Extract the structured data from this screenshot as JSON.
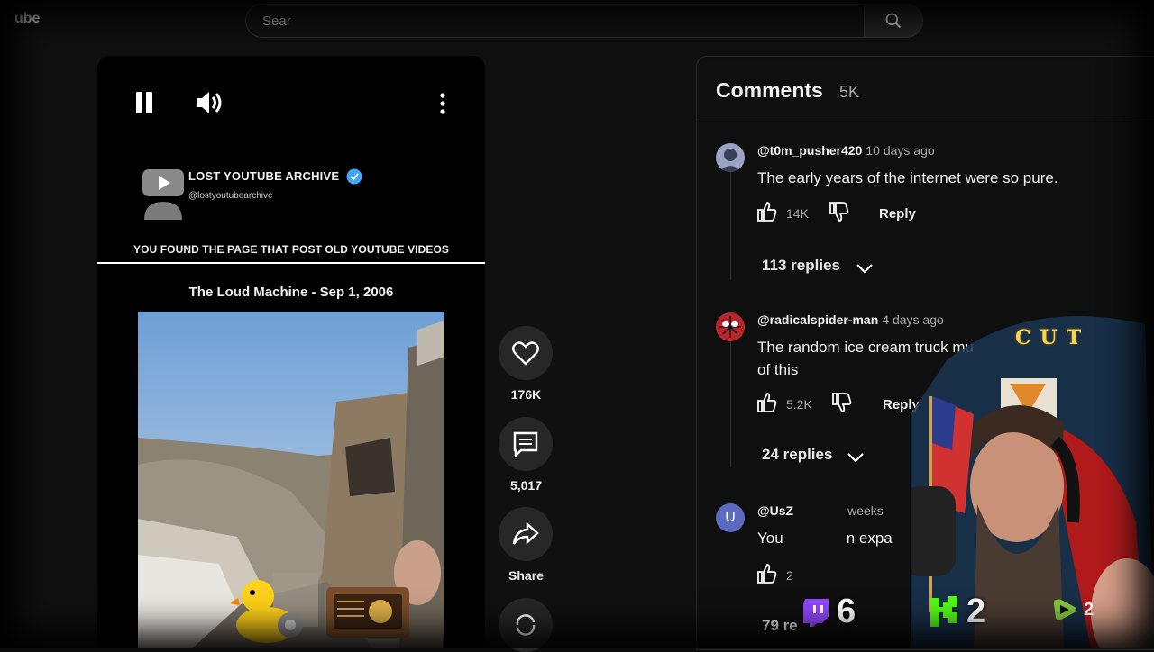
{
  "topbar": {
    "brand_fragment": "ube",
    "search_value": "Sear"
  },
  "short": {
    "channel_name": "LOST YOUTUBE ARCHIVE",
    "channel_handle": "@lostyoutubearchive",
    "tagline": "YOU FOUND THE PAGE THAT POST OLD YOUTUBE VIDEOS",
    "video_title": "The Loud Machine - Sep 1, 2006"
  },
  "actions": {
    "like_count": "176K",
    "comment_count": "5,017",
    "share_label": "Share"
  },
  "comments": {
    "heading": "Comments",
    "count": "5K",
    "items": [
      {
        "author": "@t0m_pusher420",
        "time": "10 days ago",
        "text": "The early years of the internet were so pure.",
        "likes": "14K",
        "reply_label": "Reply",
        "replies": "113 replies"
      },
      {
        "author": "@radicalspider-man",
        "time": "4 days ago",
        "text": "The random ice cream truck mu",
        "text2": "of this",
        "likes": "5.2K",
        "reply_label": "Reply",
        "replies": "24 replies"
      },
      {
        "author": "@UsZ",
        "time": "weeks",
        "avatar_letter": "U",
        "text": "You",
        "text_tail": "n expa",
        "likes": "2",
        "replies": "79 re"
      }
    ]
  },
  "overlay": {
    "cut_text": "CUT",
    "twitch_count": "6",
    "kick_count": "2",
    "rumble_count": "2"
  },
  "colors": {
    "accent_blue": "#3ea6ff",
    "twitch": "#9146ff",
    "kick": "#53fc18",
    "rumble": "#85c742"
  }
}
